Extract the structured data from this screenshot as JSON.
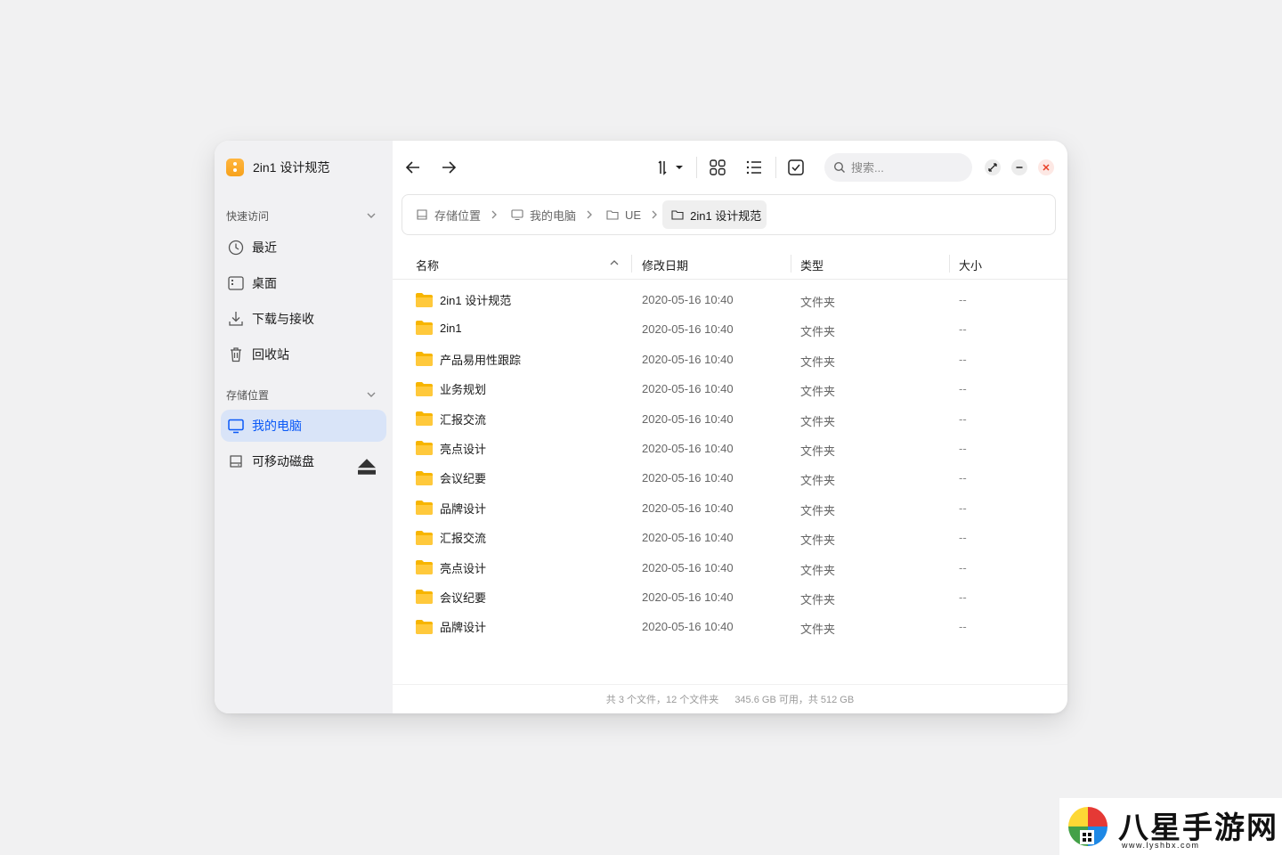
{
  "app": {
    "title": "2in1 设计规范"
  },
  "sidebar": {
    "quick_access": {
      "label": "快速访问",
      "items": [
        {
          "label": "最近",
          "icon": "clock-icon"
        },
        {
          "label": "桌面",
          "icon": "desktop-icon"
        },
        {
          "label": "下载与接收",
          "icon": "download-icon"
        },
        {
          "label": "回收站",
          "icon": "trash-icon"
        }
      ]
    },
    "storage": {
      "label": "存储位置",
      "items": [
        {
          "label": "我的电脑",
          "icon": "monitor-icon",
          "active": true
        },
        {
          "label": "可移动磁盘",
          "icon": "removable-disk-icon"
        }
      ]
    }
  },
  "toolbar": {
    "search_placeholder": "搜索..."
  },
  "breadcrumb": [
    {
      "label": "存储位置",
      "icon": "drive-icon"
    },
    {
      "label": "我的电脑",
      "icon": "monitor-icon"
    },
    {
      "label": "UE",
      "icon": "folder-icon"
    },
    {
      "label": "2in1 设计规范",
      "icon": "folder-icon"
    }
  ],
  "table": {
    "columns": {
      "name": "名称",
      "date": "修改日期",
      "type": "类型",
      "size": "大小"
    },
    "rows": [
      {
        "name": "2in1 设计规范",
        "date": "2020-05-16  10:40",
        "type": "文件夹",
        "size": "--"
      },
      {
        "name": "2in1",
        "date": "2020-05-16  10:40",
        "type": "文件夹",
        "size": "--"
      },
      {
        "name": "产品易用性跟踪",
        "date": "2020-05-16  10:40",
        "type": "文件夹",
        "size": "--"
      },
      {
        "name": "业务规划",
        "date": "2020-05-16  10:40",
        "type": "文件夹",
        "size": "--"
      },
      {
        "name": "汇报交流",
        "date": "2020-05-16  10:40",
        "type": "文件夹",
        "size": "--"
      },
      {
        "name": "亮点设计",
        "date": "2020-05-16  10:40",
        "type": "文件夹",
        "size": "--"
      },
      {
        "name": "会议纪要",
        "date": "2020-05-16  10:40",
        "type": "文件夹",
        "size": "--"
      },
      {
        "name": "品牌设计",
        "date": "2020-05-16  10:40",
        "type": "文件夹",
        "size": "--"
      },
      {
        "name": "汇报交流",
        "date": "2020-05-16  10:40",
        "type": "文件夹",
        "size": "--"
      },
      {
        "name": "亮点设计",
        "date": "2020-05-16  10:40",
        "type": "文件夹",
        "size": "--"
      },
      {
        "name": "会议纪要",
        "date": "2020-05-16  10:40",
        "type": "文件夹",
        "size": "--"
      },
      {
        "name": "品牌设计",
        "date": "2020-05-16  10:40",
        "type": "文件夹",
        "size": "--"
      }
    ]
  },
  "status": {
    "count": "共 3 个文件，12 个文件夹",
    "space": "345.6 GB 可用，共 512 GB"
  },
  "watermark": {
    "text": "八星手游网",
    "url": "www.lyshbx.com"
  },
  "colors": {
    "accent": "#0a59f7",
    "active_bg": "#d9e4f8",
    "folder": "#f7b500",
    "close": "#e84026"
  }
}
